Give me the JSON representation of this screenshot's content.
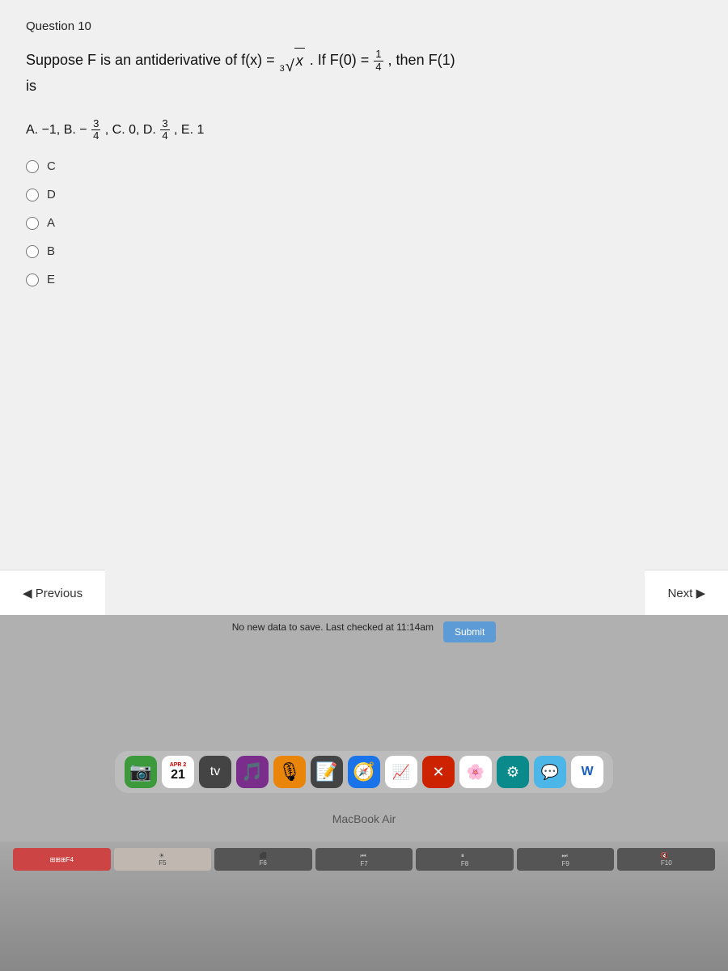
{
  "question": {
    "number": "Question 10",
    "text_prefix": "Suppose F is an antiderivative of f(x) = ",
    "text_mid": ". If F(0) = ",
    "text_suffix": ", then F(1)",
    "second_line": "is",
    "f_zero_num": "1",
    "f_zero_den": "4",
    "choices_label": "A. −1, B. −",
    "choices_b_num": "3",
    "choices_b_den": "4",
    "choices_c": ", C. 0, D. ",
    "choices_d_num": "3",
    "choices_d_den": "4",
    "choices_e": ", E. 1"
  },
  "options": [
    {
      "id": "C",
      "label": "C"
    },
    {
      "id": "D",
      "label": "D"
    },
    {
      "id": "A",
      "label": "A"
    },
    {
      "id": "B",
      "label": "B"
    },
    {
      "id": "E",
      "label": "E"
    }
  ],
  "nav": {
    "previous": "◀ Previous",
    "next": "Next ▶"
  },
  "status": {
    "text": "No new data to save. Last checked at 11:14am",
    "submit": "Submit"
  },
  "dock": {
    "date_top": "APR 2",
    "date_num": "21"
  },
  "macbook_label": "MacBook Air",
  "fn_keys": [
    "F4",
    "F5",
    "F6",
    "F7",
    "F8",
    "F9",
    "F10"
  ]
}
